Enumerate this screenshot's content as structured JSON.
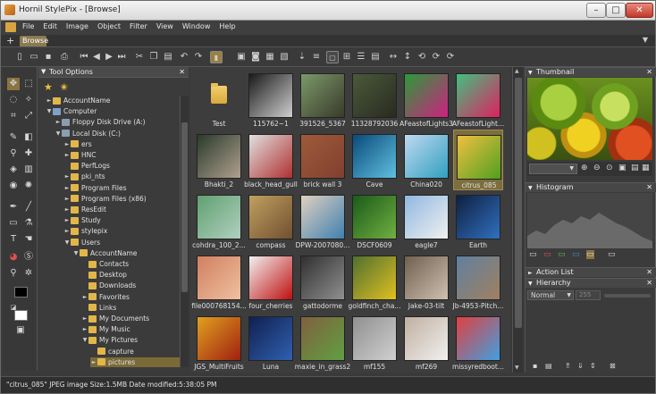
{
  "window": {
    "title": "Hornil StylePix - [Browse]"
  },
  "menu": [
    "File",
    "Edit",
    "Image",
    "Object",
    "Filter",
    "View",
    "Window",
    "Help"
  ],
  "tab": {
    "label": "Browse"
  },
  "tool_options": {
    "title": "Tool Options"
  },
  "tree": [
    {
      "label": "AccountName",
      "level": 1,
      "type": "folder",
      "arrow": "►"
    },
    {
      "label": "Computer",
      "level": 1,
      "type": "comp",
      "arrow": "▼"
    },
    {
      "label": "Floppy Disk Drive (A:)",
      "level": 2,
      "type": "drv",
      "arrow": "►"
    },
    {
      "label": "Local Disk (C:)",
      "level": 2,
      "type": "drv",
      "arrow": "▼"
    },
    {
      "label": "ers",
      "level": 3,
      "type": "folder",
      "arrow": "►"
    },
    {
      "label": "HNC",
      "level": 3,
      "type": "folder",
      "arrow": "►"
    },
    {
      "label": "PerfLogs",
      "level": 3,
      "type": "folder",
      "arrow": ""
    },
    {
      "label": "pki_nts",
      "level": 3,
      "type": "folder",
      "arrow": "►"
    },
    {
      "label": "Program Files",
      "level": 3,
      "type": "folder",
      "arrow": "►"
    },
    {
      "label": "Program Files (x86)",
      "level": 3,
      "type": "folder",
      "arrow": "►"
    },
    {
      "label": "ResEdit",
      "level": 3,
      "type": "folder",
      "arrow": "►"
    },
    {
      "label": "Study",
      "level": 3,
      "type": "folder",
      "arrow": "►"
    },
    {
      "label": "stylepix",
      "level": 3,
      "type": "folder",
      "arrow": "►"
    },
    {
      "label": "Users",
      "level": 3,
      "type": "folder",
      "arrow": "▼"
    },
    {
      "label": "AccountName",
      "level": 4,
      "type": "folder",
      "arrow": "▼"
    },
    {
      "label": "Contacts",
      "level": 5,
      "type": "folder",
      "arrow": ""
    },
    {
      "label": "Desktop",
      "level": 5,
      "type": "folder",
      "arrow": ""
    },
    {
      "label": "Downloads",
      "level": 5,
      "type": "folder",
      "arrow": ""
    },
    {
      "label": "Favorites",
      "level": 5,
      "type": "folder",
      "arrow": "►"
    },
    {
      "label": "Links",
      "level": 5,
      "type": "folder",
      "arrow": ""
    },
    {
      "label": "My Documents",
      "level": 5,
      "type": "folder",
      "arrow": "►"
    },
    {
      "label": "My Music",
      "level": 5,
      "type": "folder",
      "arrow": "►"
    },
    {
      "label": "My Pictures",
      "level": 5,
      "type": "folder",
      "arrow": "▼"
    },
    {
      "label": "capture",
      "level": 6,
      "type": "folder",
      "arrow": ""
    },
    {
      "label": "pictures",
      "level": 6,
      "type": "folder",
      "arrow": "►",
      "selected": true
    }
  ],
  "thumbnails": [
    {
      "name": "Test",
      "colors": [
        "#3d3d3d",
        "#3d3d3d"
      ],
      "folder": true
    },
    {
      "name": "115762~1",
      "colors": [
        "#1a1a1a",
        "#cfcfcf"
      ]
    },
    {
      "name": "391526_5367",
      "colors": [
        "#7a9a6a",
        "#3a3a2a"
      ]
    },
    {
      "name": "11328792036",
      "colors": [
        "#4a5a3a",
        "#2a2a20"
      ]
    },
    {
      "name": "AFeastofLights3",
      "colors": [
        "#2a9a3a",
        "#d02080"
      ]
    },
    {
      "name": "AFeastofLight...",
      "colors": [
        "#40c080",
        "#e02060"
      ]
    },
    {
      "name": "Bhakti_2",
      "colors": [
        "#2a3a2a",
        "#b0a090"
      ]
    },
    {
      "name": "black_head_gull",
      "colors": [
        "#e0e0e0",
        "#b03030"
      ]
    },
    {
      "name": "brick wall 3",
      "colors": [
        "#a05a3a",
        "#804030"
      ]
    },
    {
      "name": "Cave",
      "colors": [
        "#0a4a7a",
        "#60c0e0"
      ]
    },
    {
      "name": "China020",
      "colors": [
        "#c0d8f0",
        "#30a0c0"
      ]
    },
    {
      "name": "citrus_085",
      "colors": [
        "#f0c040",
        "#50a020"
      ],
      "selected": true
    },
    {
      "name": "cohdra_100_2...",
      "colors": [
        "#60a070",
        "#b0d0c0"
      ]
    },
    {
      "name": "compass",
      "colors": [
        "#c0a060",
        "#705030"
      ]
    },
    {
      "name": "DPW-2007080...",
      "colors": [
        "#e0d0c0",
        "#4080b0"
      ]
    },
    {
      "name": "DSCF0609",
      "colors": [
        "#1a5a1a",
        "#70b040"
      ]
    },
    {
      "name": "eagle7",
      "colors": [
        "#90b8e0",
        "#f0f0f0"
      ]
    },
    {
      "name": "Earth",
      "colors": [
        "#102040",
        "#3070c0"
      ]
    },
    {
      "name": "file000768154...",
      "colors": [
        "#d08060",
        "#f0c0a0"
      ]
    },
    {
      "name": "four_cherries",
      "colors": [
        "#f0f0f0",
        "#c01010"
      ]
    },
    {
      "name": "gattodorme",
      "colors": [
        "#303030",
        "#909090"
      ]
    },
    {
      "name": "goldfinch_cha...",
      "colors": [
        "#507030",
        "#e0c020"
      ]
    },
    {
      "name": "Jake-03-tilt",
      "colors": [
        "#706050",
        "#d0c0b0"
      ]
    },
    {
      "name": "Jb-4953-Pitch...",
      "colors": [
        "#6080a0",
        "#a08060"
      ]
    },
    {
      "name": "JGS_MultiFruits",
      "colors": [
        "#e0a020",
        "#a02010"
      ]
    },
    {
      "name": "Luna",
      "colors": [
        "#102050",
        "#3060b0"
      ]
    },
    {
      "name": "maxie_in_grass2",
      "colors": [
        "#806040",
        "#60a040"
      ]
    },
    {
      "name": "mf155",
      "colors": [
        "#909090",
        "#d0d0d0"
      ]
    },
    {
      "name": "mf269",
      "colors": [
        "#c0b0a0",
        "#f0f0f0"
      ]
    },
    {
      "name": "missyredboot...",
      "colors": [
        "#e04040",
        "#40a0e0"
      ]
    }
  ],
  "panels": {
    "thumbnail": "Thumbnail",
    "histogram": "Histogram",
    "action_list": "Action List",
    "hierarchy": "Hierarchy",
    "blend_mode": "Normal",
    "opacity": "255"
  },
  "status": "\"citrus_085\" JPEG image Size:1.5MB Date modified:5:38:05 PM"
}
